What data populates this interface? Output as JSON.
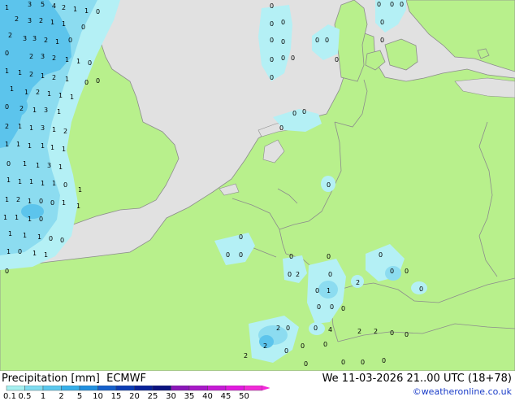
{
  "title": "Precipitation [mm]",
  "model": "ECMWF",
  "valid_time": "We 11-03-2026 21..00 UTC (18+78)",
  "credit": "©weatheronline.co.uk",
  "legend": {
    "labels": [
      "0.1",
      "0.5",
      "1",
      "2",
      "5",
      "10",
      "15",
      "20",
      "25",
      "30",
      "35",
      "40",
      "45",
      "50"
    ],
    "colors": [
      "#a6f0f0",
      "#7fdcf0",
      "#5ac8ee",
      "#37b0ea",
      "#2090e0",
      "#1460cc",
      "#0b3cb4",
      "#08229a",
      "#0b1280",
      "#8a16b8",
      "#a818c8",
      "#c61ad6",
      "#e21ae0",
      "#f22ad8"
    ]
  },
  "colors": {
    "sea": "#e1e1e1",
    "land": "#b8f08c",
    "border": "#8c8c8c",
    "precip_light": "#b4f0f5",
    "precip_medium": "#8cdcf0",
    "precip_heavy": "#5cc4ec"
  },
  "map_values": [
    "1",
    "3",
    "5",
    "4",
    "2",
    "1",
    "1",
    "0",
    "2",
    "3",
    "2",
    "1",
    "1",
    "0",
    "2",
    "3",
    "3",
    "2",
    "1",
    "0",
    "0",
    "2",
    "3",
    "2",
    "1",
    "1",
    "0",
    "1",
    "1",
    "2",
    "1",
    "2",
    "1",
    "0",
    "0",
    "1",
    "1",
    "2",
    "1",
    "1",
    "1",
    "0",
    "2",
    "1",
    "3",
    "1",
    "2",
    "1",
    "1",
    "3",
    "1",
    "2",
    "1",
    "1",
    "1",
    "1",
    "1",
    "1",
    "0",
    "1",
    "1",
    "3",
    "1",
    "1",
    "1",
    "1",
    "1",
    "1",
    "0",
    "1",
    "1",
    "2",
    "1",
    "0",
    "0",
    "1",
    "1",
    "1",
    "1",
    "1",
    "0",
    "1",
    "1",
    "1",
    "0",
    "0",
    "1",
    "0",
    "1",
    "1",
    "0",
    "0",
    "0",
    "0",
    "0",
    "0",
    "0",
    "0",
    "0",
    "0",
    "0",
    "0",
    "0",
    "0",
    "0",
    "0",
    "0",
    "0",
    "0",
    "0",
    "0",
    "0",
    "0",
    "0",
    "0",
    "0",
    "0",
    "0",
    "0",
    "2",
    "2",
    "0",
    "0",
    "1",
    "2",
    "0",
    "0",
    "0",
    "0",
    "0",
    "0",
    "0",
    "2",
    "0",
    "4",
    "0",
    "0",
    "0",
    "2",
    "2",
    "0",
    "0",
    "2",
    "0",
    "0",
    "0",
    "0",
    "0",
    "0",
    "0",
    "0",
    "0",
    "0",
    "0",
    "0",
    "0",
    "0",
    "0",
    "0",
    "0",
    "0",
    "0"
  ]
}
